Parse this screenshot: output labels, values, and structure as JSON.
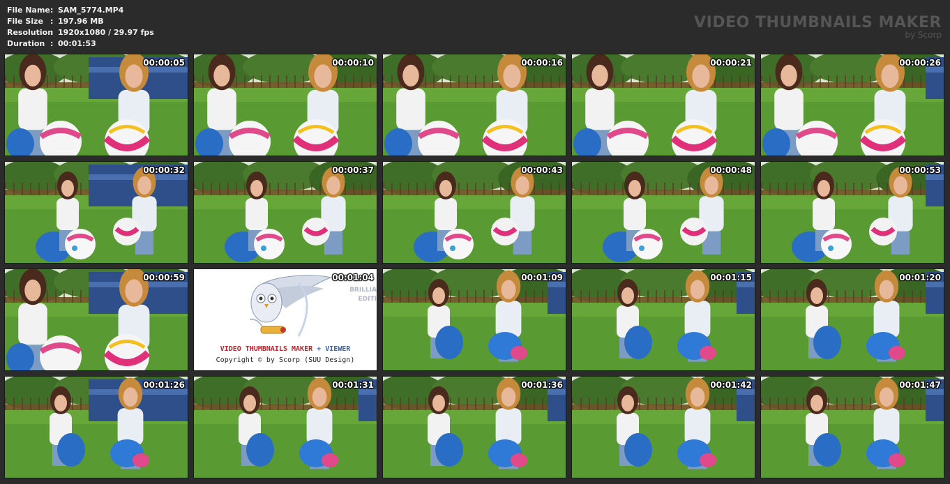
{
  "file_info": {
    "rows": [
      {
        "key": "File Name",
        "sep": ":",
        "value": "SAM_5774.MP4"
      },
      {
        "key": "File Size",
        "sep": ":",
        "value": "197.96 MB"
      },
      {
        "key": "Resolution",
        "sep": ":",
        "value": "1920x1080 / 29.97 fps"
      },
      {
        "key": "Duration",
        "sep": ":",
        "value": "00:01:53"
      }
    ]
  },
  "brand": {
    "title": "VIDEO THUMBNAILS MAKER",
    "subtitle": "by Scorp"
  },
  "thumbnails": [
    {
      "time": "00:00:05",
      "scene": "close"
    },
    {
      "time": "00:00:10",
      "scene": "close"
    },
    {
      "time": "00:00:16",
      "scene": "close"
    },
    {
      "time": "00:00:21",
      "scene": "close"
    },
    {
      "time": "00:00:26",
      "scene": "close"
    },
    {
      "time": "00:00:32",
      "scene": "mid"
    },
    {
      "time": "00:00:37",
      "scene": "mid"
    },
    {
      "time": "00:00:43",
      "scene": "mid"
    },
    {
      "time": "00:00:48",
      "scene": "mid"
    },
    {
      "time": "00:00:53",
      "scene": "mid"
    },
    {
      "time": "00:00:59",
      "scene": "close"
    },
    {
      "time": "00:01:04",
      "scene": "logo"
    },
    {
      "time": "00:01:09",
      "scene": "stand"
    },
    {
      "time": "00:01:15",
      "scene": "stand"
    },
    {
      "time": "00:01:20",
      "scene": "stand"
    },
    {
      "time": "00:01:26",
      "scene": "stand"
    },
    {
      "time": "00:01:31",
      "scene": "stand"
    },
    {
      "time": "00:01:36",
      "scene": "stand"
    },
    {
      "time": "00:01:42",
      "scene": "stand"
    },
    {
      "time": "00:01:47",
      "scene": "stand"
    }
  ],
  "logo_card": {
    "brand_part1": "VIDEO THUMBNAILS MAKER",
    "brand_plus": "+",
    "brand_part2": "VIEWER",
    "copyright": "Copyright © by Scorp (SUU Design)",
    "side_text_1": "BRILLIA",
    "side_text_2": "EDITI"
  },
  "colors": {
    "background": "#2b2b2b",
    "grass": "#5a9a32",
    "train": "#2e4f8a",
    "logo_red": "#b8222a",
    "logo_blue": "#3b5ea8"
  }
}
